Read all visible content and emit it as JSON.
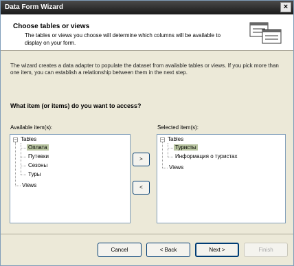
{
  "window": {
    "title": "Data Form Wizard",
    "close_label": "×"
  },
  "header": {
    "title": "Choose tables or views",
    "subtitle": "The tables or views you choose will determine which columns will be available to display on your form."
  },
  "intro": "The wizard creates a data adapter to populate the dataset from available tables or views. If you pick more than one item, you can establish a relationship between them in the next step.",
  "question": "What item (or items) do you want to access?",
  "available": {
    "label": "Available item(s):",
    "tables": "Tables",
    "items": [
      "Оплата",
      "Путевки",
      "Сезоны",
      "Туры"
    ],
    "views": "Views"
  },
  "selected": {
    "label": "Selected item(s):",
    "tables": "Tables",
    "items": [
      "Туристы",
      "Информация о туристах"
    ],
    "views": "Views"
  },
  "move_buttons": {
    "add": ">",
    "remove": "<"
  },
  "footer": {
    "cancel": "Cancel",
    "back": "< Back",
    "next": "Next >",
    "finish": "Finish"
  },
  "colors": {
    "selection": "#b8c4a0",
    "border": "#7f9db9",
    "dialog": "#ece9d8"
  }
}
